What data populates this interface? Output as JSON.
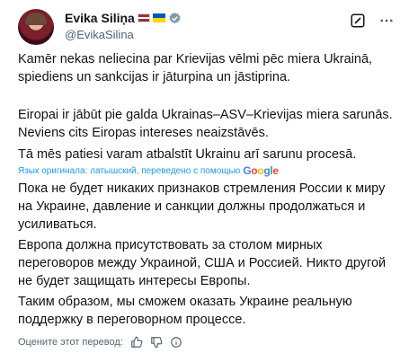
{
  "author": {
    "name": "Evika Siliņa",
    "handle": "@EvikaSilina"
  },
  "header_icons": [
    "grok-icon",
    "more-icon"
  ],
  "original_text": {
    "p1": "Kamēr nekas neliecina par Krievijas vēlmi pēc miera Ukrainā, spiediens un sankcijas ir jāturpina un jāstiprina.",
    "p2": "Eiropai ir jābūt pie galda Ukrainas–ASV–Krievijas miera sarunās. Neviens cits Eiropas intereses neaizstāvēs.",
    "p3": "Tā mēs patiesi varam atbalstīt Ukrainu arī sarunu procesā."
  },
  "translation_note": "Язык оригинала: латышский, переведено с помощью",
  "translation_provider": "Google",
  "translated_text": {
    "p1": "Пока не будет никаких признаков стремления России к миру на Украине, давление и санкции должны продолжаться и усиливаться.",
    "p2": "Европа должна присутствовать за столом мирных переговоров между Украиной, США и Россией. Никто другой не будет защищать интересы Европы.",
    "p3": "Таким образом, мы сможем оказать Украине реальную поддержку в переговорном процессе."
  },
  "rate_translation_label": "Оцените этот перевод:",
  "colors": {
    "link": "#1d9bf0",
    "text": "#0f1419",
    "secondary": "#536471"
  }
}
